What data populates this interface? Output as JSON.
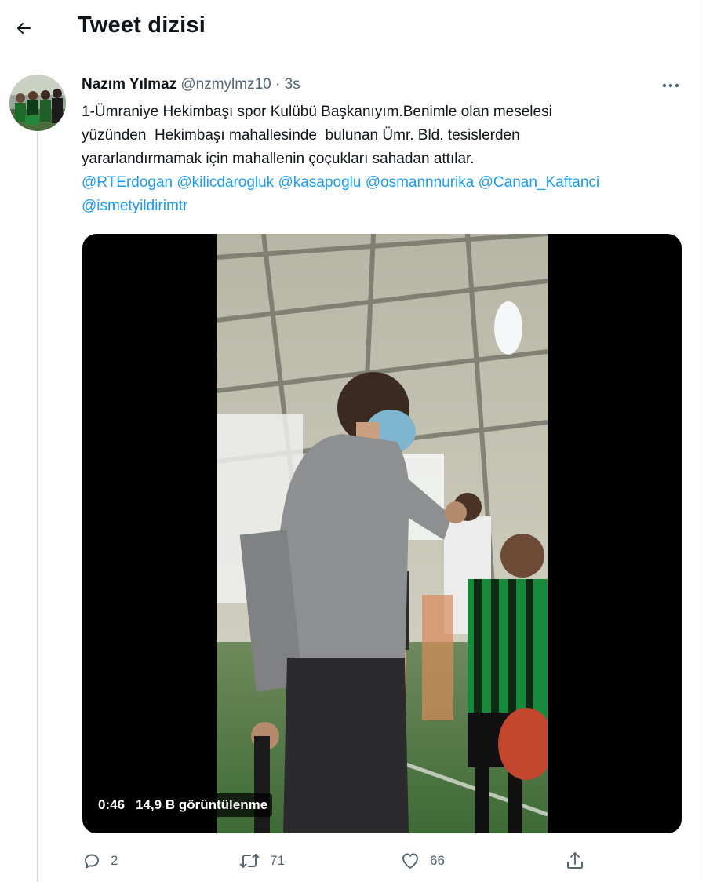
{
  "header": {
    "title": "Tweet dizisi",
    "back_icon": "arrow-left-icon"
  },
  "tweet": {
    "author_name": "Nazım Yılmaz",
    "author_handle": "@nzmylmz10",
    "separator": "·",
    "timestamp": "3s",
    "text_lines": [
      "1-Ümraniye Hekimbaşı spor Kulübü Başkanıyım.Benimle olan meselesi",
      "yüzünden  Hekimbaşı mahallesinde  bulunan Ümr. Bld. tesislerden",
      "yararlandırmamak için mahallenin çoçukları sahadan attılar."
    ],
    "mentions": [
      "@RTErdogan",
      "@kilicdarogluk",
      "@kasapoglu",
      "@osmannnurika",
      "@Canan_Kaftanci",
      "@ismetyildirimtr"
    ],
    "video": {
      "duration": "0:46",
      "views": "14,9 B görüntülenme"
    },
    "actions": {
      "replies": "2",
      "retweets": "71",
      "likes": "66"
    }
  },
  "colors": {
    "accent": "#1d9bf0",
    "text": "#0f1419",
    "secondary": "#536471",
    "thread_line": "#cfd9de"
  }
}
